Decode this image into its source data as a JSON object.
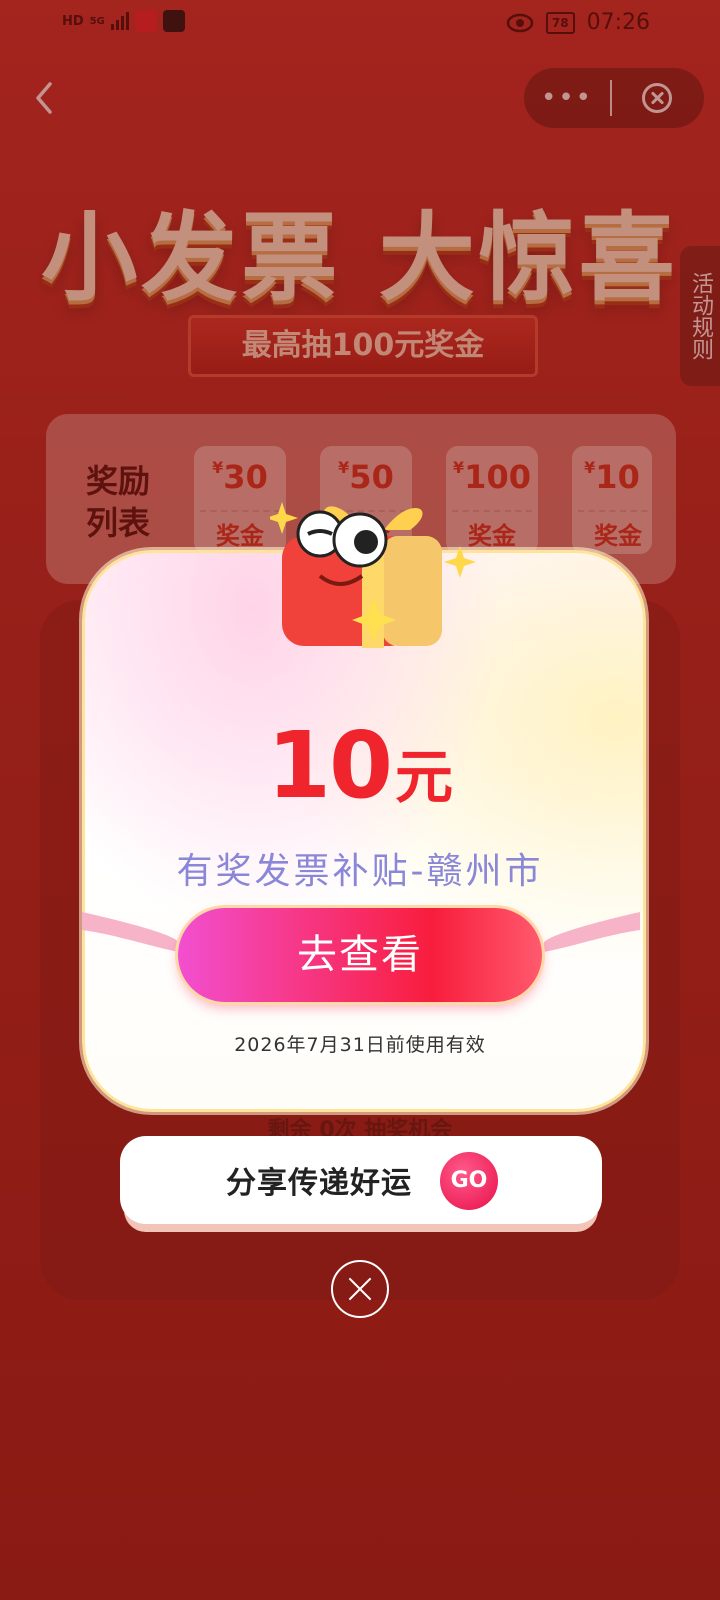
{
  "status_bar": {
    "network_label": "HD",
    "network_type": "5G",
    "battery": "78",
    "time": "07:26"
  },
  "nav": {
    "back_icon": "chevron-left-icon",
    "more_label": "•••",
    "close_icon": "close-circle-icon"
  },
  "page": {
    "hero_title": "小发票 大惊喜",
    "hero_subtitle": "最高抽100元奖金",
    "side_rules": "活动规则",
    "reward_list_title": "奖励列表",
    "rewards": [
      {
        "currency": "¥",
        "amount": "30",
        "label": "奖金"
      },
      {
        "currency": "¥",
        "amount": "50",
        "label": "奖金"
      },
      {
        "currency": "¥",
        "amount": "100",
        "label": "奖金"
      },
      {
        "currency": "¥",
        "amount": "10",
        "label": "奖金"
      }
    ],
    "draw_remaining": "剩余 0次 抽奖机会"
  },
  "modal": {
    "amount": "10",
    "unit": "元",
    "coupon_name": "有奖发票补贴-赣州市",
    "view_button": "去查看",
    "validity": "2026年7月31日前使用有效"
  },
  "share": {
    "label": "分享传递好运",
    "go_label": "GO"
  },
  "colors": {
    "accent_red": "#f0242c",
    "coupon_text": "#8a87d8",
    "background": "#b02a22"
  }
}
